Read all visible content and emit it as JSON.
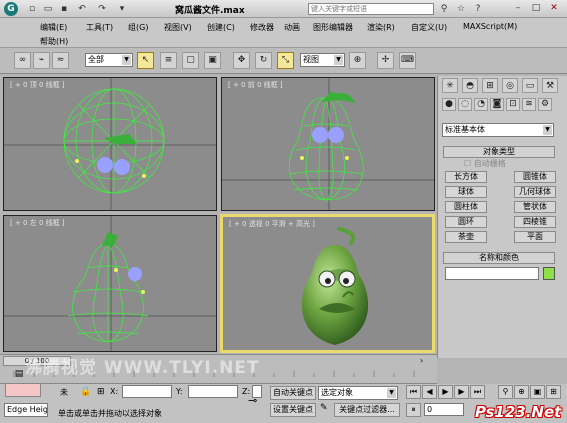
{
  "window": {
    "title": "窝瓜酱文件.max",
    "search_placeholder": "键入关键字或短语"
  },
  "menu": {
    "row1": [
      "编辑(E)",
      "工具(T)",
      "组(G)",
      "视图(V)",
      "创建(C)",
      "修改器",
      "动画",
      "图形编辑器",
      "渲染(R)",
      "自定义(U)",
      "MAXScript(M)"
    ],
    "row2": [
      "帮助(H)"
    ]
  },
  "toolbar": {
    "selection_filter": "全部",
    "reference_coord": "视图"
  },
  "viewports": {
    "top": "[ + 0 顶 0 线框 ]",
    "front": "[ + 0 前 0 线框 ]",
    "left": "[ + 0 左 0 线框 ]",
    "perspective": "[ + 0 透视 0 平滑 + 高光 ]"
  },
  "command_panel": {
    "category": "标准基本体",
    "object_type_header": "对象类型",
    "autogrid_label": "自动栅格",
    "buttons": [
      "长方体",
      "圆锥体",
      "球体",
      "几何球体",
      "圆柱体",
      "管状体",
      "圆环",
      "四棱锥",
      "茶壶",
      "平面"
    ],
    "name_color_header": "名称和颜色",
    "object_color": "#8ee04a"
  },
  "timeline": {
    "frame_indicator": "0 / 100"
  },
  "statusbar": {
    "selected_label": "未",
    "x_label": "X:",
    "y_label": "Y:",
    "z_label": "Z:",
    "maxscript_field": "Edge Heig",
    "prompt": "单击或单击并拖动以选择对象",
    "auto_key": "自动关键点",
    "selected_set": "选定对象",
    "set_key": "设置关键点",
    "key_filters": "关键点过滤器...",
    "frame_field": "0"
  },
  "watermarks": {
    "center": "沸腾视觉 WWW.TLYI.NET",
    "corner": "Ps123.Net"
  },
  "colors": {
    "wire": "#3cf03c",
    "active_border": "#ead96c",
    "stem": "#3ab03a",
    "eye": "#9aa0ff"
  }
}
